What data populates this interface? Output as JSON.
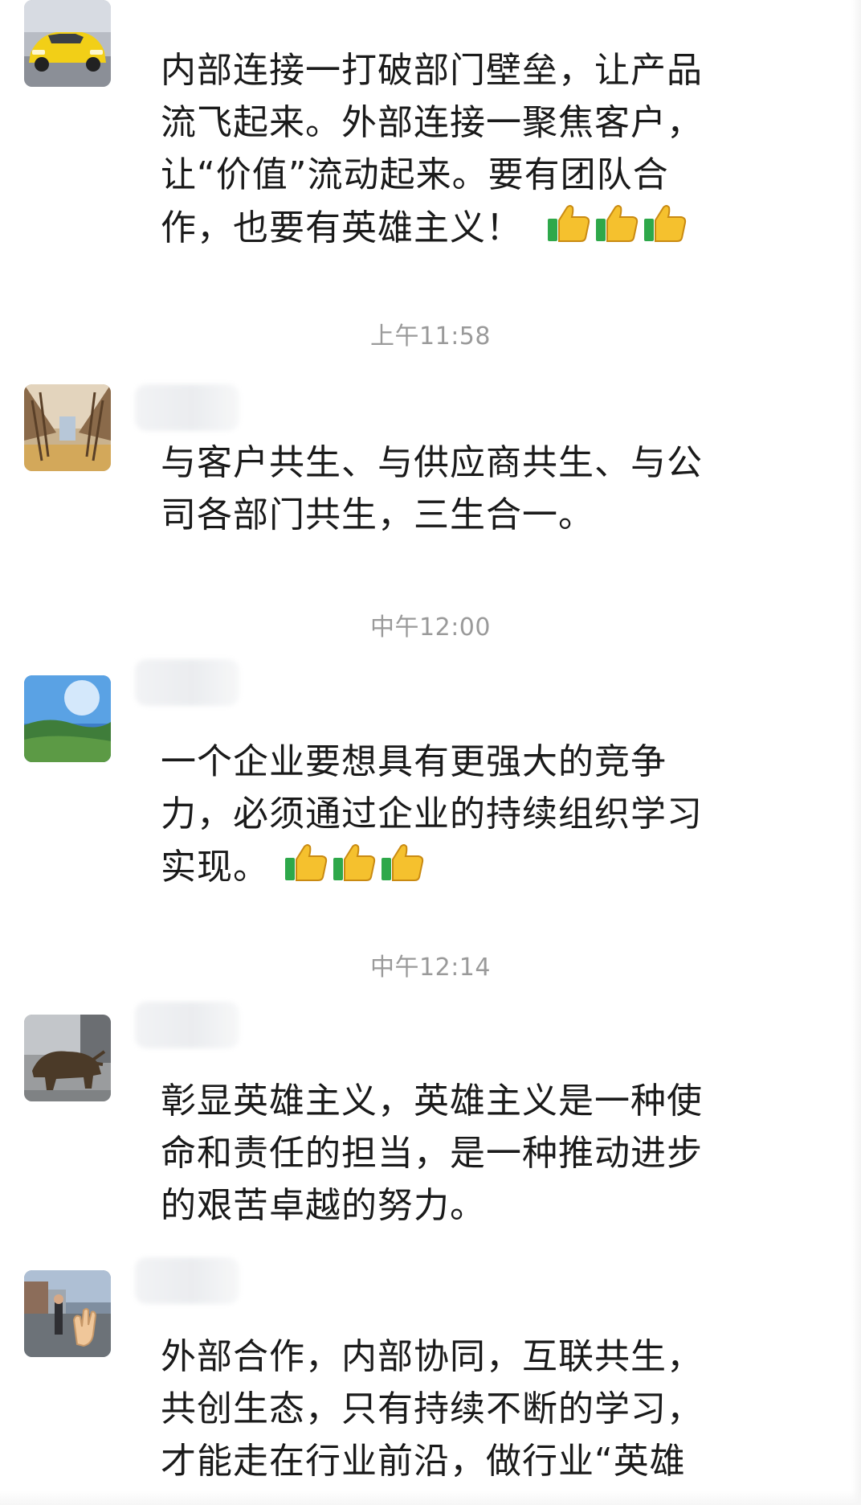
{
  "messages": [
    {
      "avatar_icon": "yellow-car-avatar-icon",
      "lines": [
        "内部连接一打破部门壁垒，让产品",
        "流飞起来。外部连接一聚焦客户，",
        "让“价值”流动起来。要有团队合",
        "作，也要有英雄主义！"
      ],
      "emoji": [
        "thumbs-up-icon",
        "thumbs-up-icon",
        "thumbs-up-icon"
      ]
    },
    {
      "timestamp": "上午11:58",
      "avatar_icon": "tree-avenue-avatar-icon",
      "lines": [
        "与客户共生、与供应商共生、与公",
        "司各部门共生，三生合一。"
      ]
    },
    {
      "timestamp": "中午12:00",
      "avatar_icon": "sky-landscape-avatar-icon",
      "lines": [
        "一个企业要想具有更强大的竞争",
        "力，必须通过企业的持续组织学习",
        "实现。"
      ],
      "emoji": [
        "thumbs-up-icon",
        "thumbs-up-icon",
        "thumbs-up-icon"
      ]
    },
    {
      "timestamp": "中午12:14",
      "avatar_icon": "bull-statue-avatar-icon",
      "lines": [
        "彰显英雄主义，英雄主义是一种使",
        "命和责任的担当，是一种推动进步",
        "的艰苦卓越的努力。"
      ]
    },
    {
      "avatar_icon": "street-hand-avatar-icon",
      "lines": [
        "外部合作，内部协同，互联共生，",
        "共创生态，只有持续不断的学习，",
        "才能走在行业前沿，做行业“英雄"
      ]
    }
  ]
}
